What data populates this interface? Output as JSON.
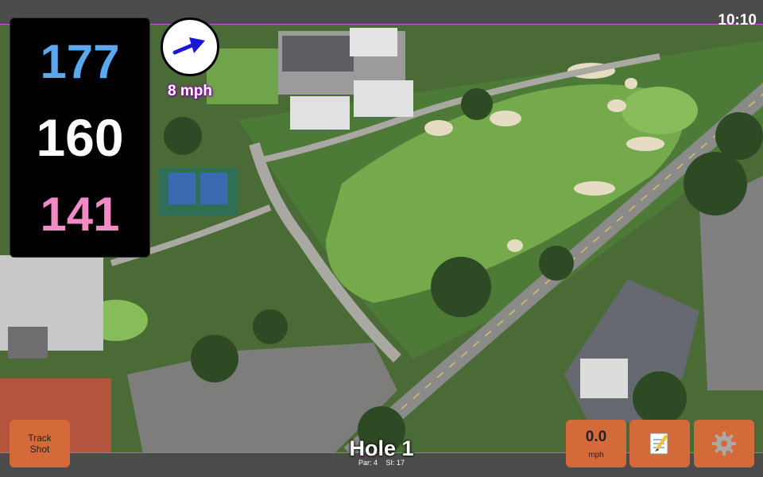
{
  "status_bar": {
    "time": "10:10"
  },
  "yardages": {
    "back": "177",
    "middle": "160",
    "front": "141"
  },
  "wind": {
    "speed_label": "8 mph",
    "direction_icon": "arrow-right-icon"
  },
  "buttons": {
    "track_shot_line1": "Track",
    "track_shot_line2": "Shot",
    "speed_value": "0.0",
    "speed_unit": "mph",
    "notes_icon": "notepad-icon",
    "settings_icon": "gear-icon"
  },
  "hole": {
    "title": "Hole 1",
    "par": "Par: 4",
    "si": "SI: 17"
  },
  "colors": {
    "back": "#5aa8ee",
    "middle": "#ffffff",
    "front": "#f28ac6",
    "button": "#d46a3a",
    "wind_glow": "#a000c0"
  }
}
